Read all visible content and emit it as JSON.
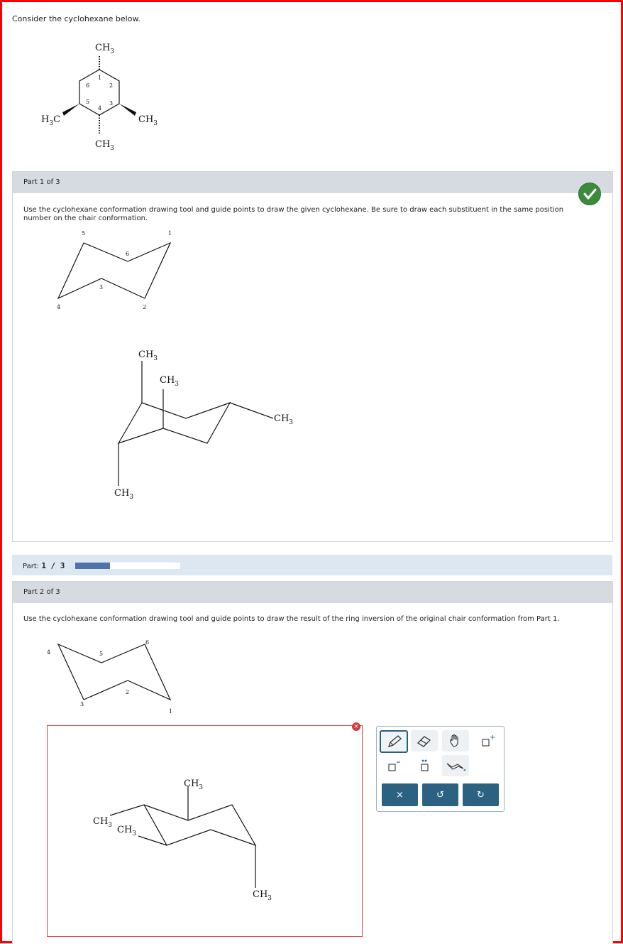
{
  "intro": "Consider the cyclohexane below.",
  "labels": {
    "ch3": "CH",
    "sub3": "3",
    "h3c_h": "H",
    "h3c_c": "C"
  },
  "colors": {
    "check": "#3c8a3c",
    "progress": "#4e72aa",
    "toolbar_button": "#2c6281",
    "frame": "#ff0000"
  },
  "top_structure": {
    "ring_numbers": [
      "1",
      "2",
      "3",
      "4",
      "5",
      "6"
    ]
  },
  "part1": {
    "header": "Part 1 of 3",
    "instruction": "Use the cyclohexane conformation drawing tool and guide points to draw the given cyclohexane. Be sure to draw each substituent in the same position number on the chair conformation.",
    "guide_numbers": [
      "5",
      "1",
      "6",
      "3",
      "4",
      "2"
    ],
    "status_icon": "check-icon"
  },
  "progress": {
    "label": "Part:",
    "value": "1 / 3",
    "fraction": 0.333
  },
  "part2": {
    "header": "Part 2 of 3",
    "instruction": "Use the cyclohexane conformation drawing tool and guide points to draw the result of the ring inversion of the original chair conformation from Part 1.",
    "guide_numbers": [
      "4",
      "5",
      "6",
      "3",
      "2",
      "1"
    ]
  },
  "toolbar": {
    "tools": [
      "pencil-icon",
      "eraser-icon",
      "hand-icon",
      "add-charge-icon",
      "remove-charge-icon",
      "lone-pair-icon",
      "chair-template-icon"
    ],
    "clear": "×",
    "undo": "↺",
    "redo": "↻"
  }
}
